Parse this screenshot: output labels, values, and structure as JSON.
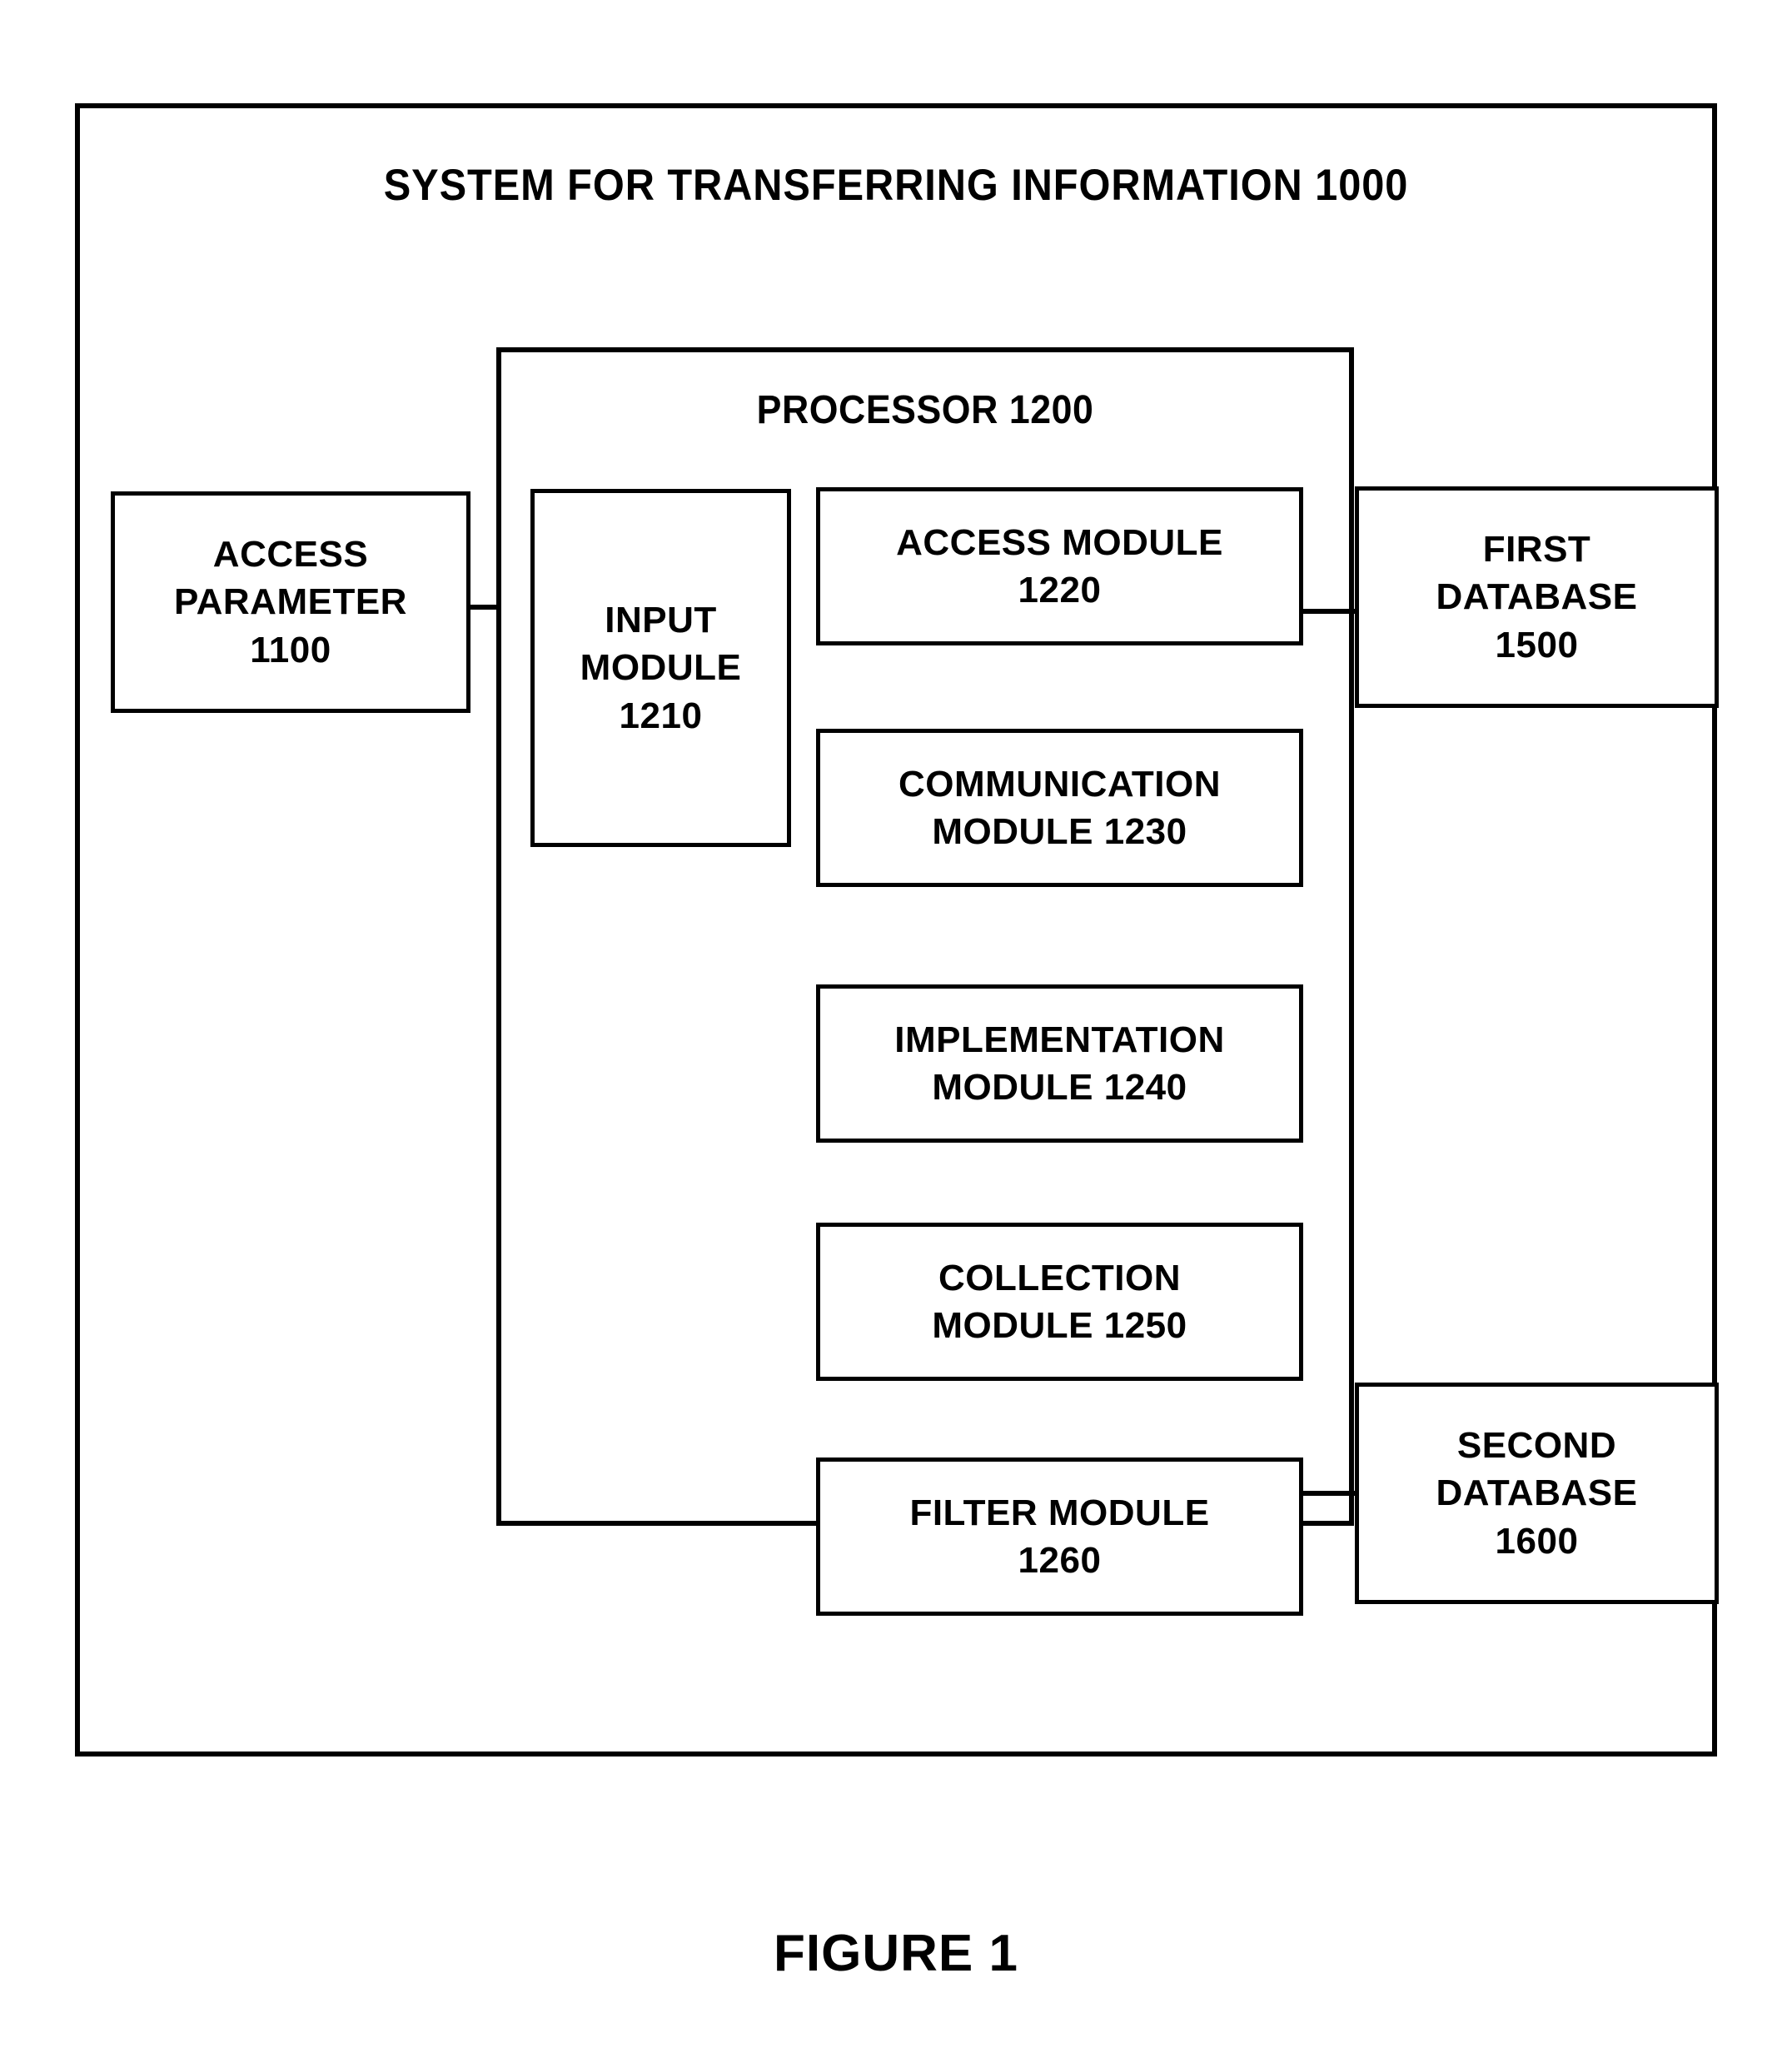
{
  "figure": {
    "caption": "FIGURE 1"
  },
  "system": {
    "title": "SYSTEM FOR TRANSFERRING INFORMATION 1000",
    "reference_numeral": "1000"
  },
  "processor": {
    "title": "PROCESSOR 1200",
    "reference_numeral": "1200"
  },
  "boxes": {
    "access_parameter": {
      "label": "ACCESS\nPARAMETER\n1100",
      "reference_numeral": "1100"
    },
    "input_module": {
      "label": "INPUT\nMODULE\n1210",
      "reference_numeral": "1210"
    },
    "access_module": {
      "label": "ACCESS MODULE\n1220",
      "reference_numeral": "1220"
    },
    "communication_module": {
      "label": "COMMUNICATION\nMODULE 1230",
      "reference_numeral": "1230"
    },
    "implementation_module": {
      "label": "IMPLEMENTATION\nMODULE 1240",
      "reference_numeral": "1240"
    },
    "collection_module": {
      "label": "COLLECTION\nMODULE 1250",
      "reference_numeral": "1250"
    },
    "filter_module": {
      "label": "FILTER MODULE\n1260",
      "reference_numeral": "1260"
    },
    "first_database": {
      "label": "FIRST\nDATABASE\n1500",
      "reference_numeral": "1500"
    },
    "second_database": {
      "label": "SECOND\nDATABASE\n1600",
      "reference_numeral": "1600"
    }
  },
  "colors": {
    "ink": "#000000",
    "paper": "#ffffff"
  }
}
